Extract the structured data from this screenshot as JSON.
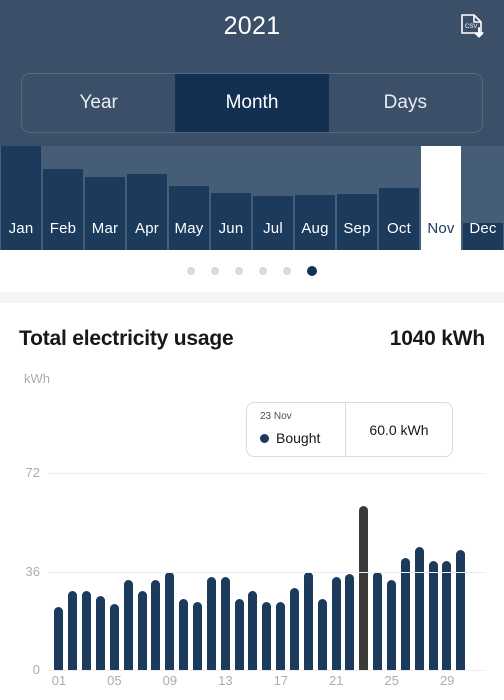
{
  "header": {
    "year": "2021",
    "export_icon": "csv-download-icon",
    "segments": [
      {
        "label": "Year",
        "active": false
      },
      {
        "label": "Month",
        "active": true
      },
      {
        "label": "Days",
        "active": false
      }
    ]
  },
  "month_strip": {
    "months": [
      {
        "label": "Jan",
        "height_pct": 100,
        "selected": false
      },
      {
        "label": "Feb",
        "height_pct": 78,
        "selected": false
      },
      {
        "label": "Mar",
        "height_pct": 70,
        "selected": false
      },
      {
        "label": "Apr",
        "height_pct": 73,
        "selected": false
      },
      {
        "label": "May",
        "height_pct": 62,
        "selected": false
      },
      {
        "label": "Jun",
        "height_pct": 55,
        "selected": false
      },
      {
        "label": "Jul",
        "height_pct": 52,
        "selected": false
      },
      {
        "label": "Aug",
        "height_pct": 53,
        "selected": false
      },
      {
        "label": "Sep",
        "height_pct": 54,
        "selected": false
      },
      {
        "label": "Oct",
        "height_pct": 60,
        "selected": false
      },
      {
        "label": "Nov",
        "height_pct": 100,
        "selected": true
      },
      {
        "label": "Dec",
        "height_pct": 26,
        "selected": false
      }
    ]
  },
  "pagination": {
    "count": 6,
    "active_index": 5
  },
  "main": {
    "title": "Total electricity usage",
    "total": "1040 kWh"
  },
  "tooltip": {
    "date": "23 Nov",
    "series_label": "Bought",
    "value": "60.0 kWh",
    "swatch_color": "#1b3A5c"
  },
  "colors": {
    "header_bg": "#3b5068",
    "month_strip_bg": "#455d77",
    "bar": "#1b3A5c",
    "bar_highlight": "#3b3a38",
    "segment_active": "#133052",
    "muted_text": "#a9adb3"
  },
  "chart_data": {
    "type": "bar",
    "title": "Total electricity usage",
    "xlabel": "",
    "ylabel": "kWh",
    "ylim": [
      0,
      72
    ],
    "yticks": [
      0,
      36,
      72
    ],
    "xticks": [
      "01",
      "05",
      "09",
      "13",
      "17",
      "21",
      "25",
      "29"
    ],
    "grid": true,
    "legend": [
      "Bought"
    ],
    "categories": [
      "01",
      "02",
      "03",
      "04",
      "05",
      "06",
      "07",
      "08",
      "09",
      "10",
      "11",
      "12",
      "13",
      "14",
      "15",
      "16",
      "17",
      "18",
      "19",
      "20",
      "21",
      "22",
      "23",
      "24",
      "25",
      "26",
      "27",
      "28",
      "29",
      "30"
    ],
    "values": [
      23,
      29,
      29,
      27,
      24,
      33,
      29,
      33,
      36,
      26,
      25,
      34,
      34,
      26,
      29,
      25,
      25,
      30,
      36,
      26,
      34,
      35,
      60,
      36,
      33,
      41,
      45,
      40,
      40,
      44
    ],
    "highlight_index": 22,
    "annotation": {
      "date": "23 Nov",
      "series": "Bought",
      "value": "60.0 kWh"
    }
  }
}
